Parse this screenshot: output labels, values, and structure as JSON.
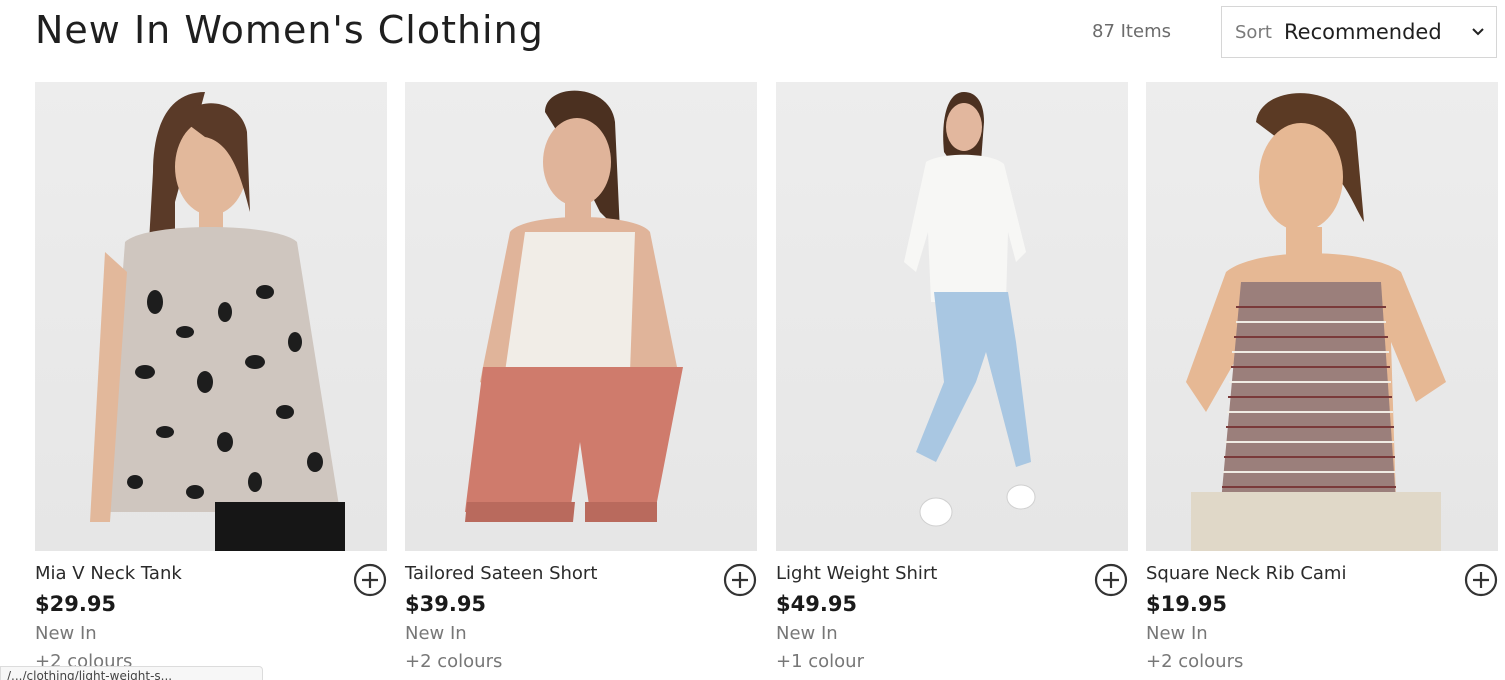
{
  "header": {
    "title": "New In Women's Clothing",
    "item_count": "87 Items",
    "sort_label": "Sort",
    "sort_value": "Recommended"
  },
  "products": [
    {
      "name": "Mia V Neck Tank",
      "price": "$29.95",
      "badge": "New In",
      "colours": "+2 colours",
      "top_color": "#cfc6bf",
      "bottom_color": "#161616"
    },
    {
      "name": "Tailored Sateen Short",
      "price": "$39.95",
      "badge": "New In",
      "colours": "+2 colours",
      "top_color": "#f1ede7",
      "bottom_color": "#cf7b6c"
    },
    {
      "name": "Light Weight Shirt",
      "price": "$49.95",
      "badge": "New In",
      "colours": "+1 colour",
      "top_color": "#f7f7f5",
      "bottom_color": "#a9c7e2"
    },
    {
      "name": "Square Neck Rib Cami",
      "price": "$19.95",
      "badge": "New In",
      "colours": "+2 colours",
      "top_color": "#9b7f7b",
      "bottom_color": "#e0d8c8"
    }
  ],
  "status_url": "/.../clothing/light-weight-s..."
}
